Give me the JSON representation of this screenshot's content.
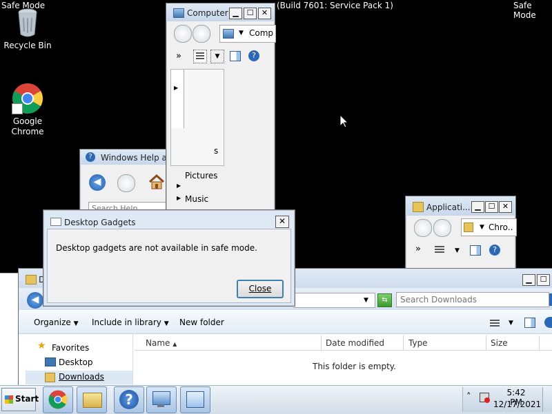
{
  "desktop": {
    "safe_mode_left": "Safe Mode",
    "safe_mode_right": "Safe Mode",
    "build_text": "(Build 7601: Service Pack 1)",
    "icons": [
      {
        "label": "Recycle Bin",
        "icon": "recycle-bin-icon"
      },
      {
        "label": "Google Chrome",
        "icon": "chrome-icon"
      }
    ]
  },
  "computer_window": {
    "title": "Computer",
    "address": "Comp",
    "more_glyph": "»",
    "tree_items": [
      "s",
      "Pictures",
      "Music"
    ]
  },
  "help_window": {
    "title": "Windows Help an",
    "search_placeholder": "Search Help"
  },
  "applications_window": {
    "title": "Applicati...",
    "address": "Chro..",
    "more_glyph": "»"
  },
  "downloads_window": {
    "title": "D",
    "search_placeholder": "Search Downloads",
    "toolbar": {
      "organize": "Organize",
      "include": "Include in library",
      "new_folder": "New folder"
    },
    "nav": [
      "Favorites",
      "Desktop",
      "Downloads"
    ],
    "columns": [
      "Name",
      "Date modified",
      "Type",
      "Size"
    ],
    "empty_message": "This folder is empty."
  },
  "gadgets_dialog": {
    "title": "Desktop Gadgets",
    "message": "Desktop gadgets are not available in safe mode.",
    "close_button": "Close",
    "close_x": "✕"
  },
  "taskbar": {
    "start_label": "Start",
    "time": "5:42 PM",
    "date": "12/17/2021",
    "tray_chevron": "˄",
    "buttons": [
      "chrome-icon",
      "explorer-folder-icon",
      "help-icon",
      "remote-desktop-icon",
      "control-panel-icon"
    ]
  },
  "colors": {
    "desktop": "#000000",
    "titlebar": "#c7d7ea",
    "taskbar": "#dfe7f0",
    "accent": "#1e5aa8"
  }
}
